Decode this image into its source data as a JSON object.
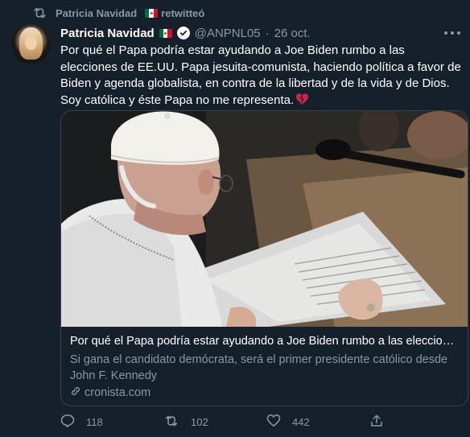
{
  "retweet": {
    "user": "Patricia Navidad",
    "action": "retwitteó",
    "icon": "retweet-icon"
  },
  "tweet": {
    "name": "Patricia Navidad",
    "handle": "@ANPNL05",
    "separator": "·",
    "date": "26 oct.",
    "text": "Por qué el Papa podría estar ayudando a Joe Biden rumbo a las elecciones de EE.UU. Papa jesuita-comunista, haciendo política a favor de Biden y agenda globalista, en contra de la libertad y de la vida y de Dios. Soy católica y éste Papa no me representa.",
    "emoji": "broken-heart-icon"
  },
  "card": {
    "title": "Por qué el Papa podría estar ayudando a Joe Biden rumbo a las elecciones de EE.UU.",
    "description": "Si gana el candidato demócrata, será el primer presidente católico desde John F. Kennedy",
    "domain": "cronista.com"
  },
  "actions": {
    "replies": "118",
    "retweets": "102",
    "likes": "442"
  },
  "colors": {
    "background": "#15202b",
    "secondary_text": "#8899a6",
    "border": "#38444d"
  }
}
